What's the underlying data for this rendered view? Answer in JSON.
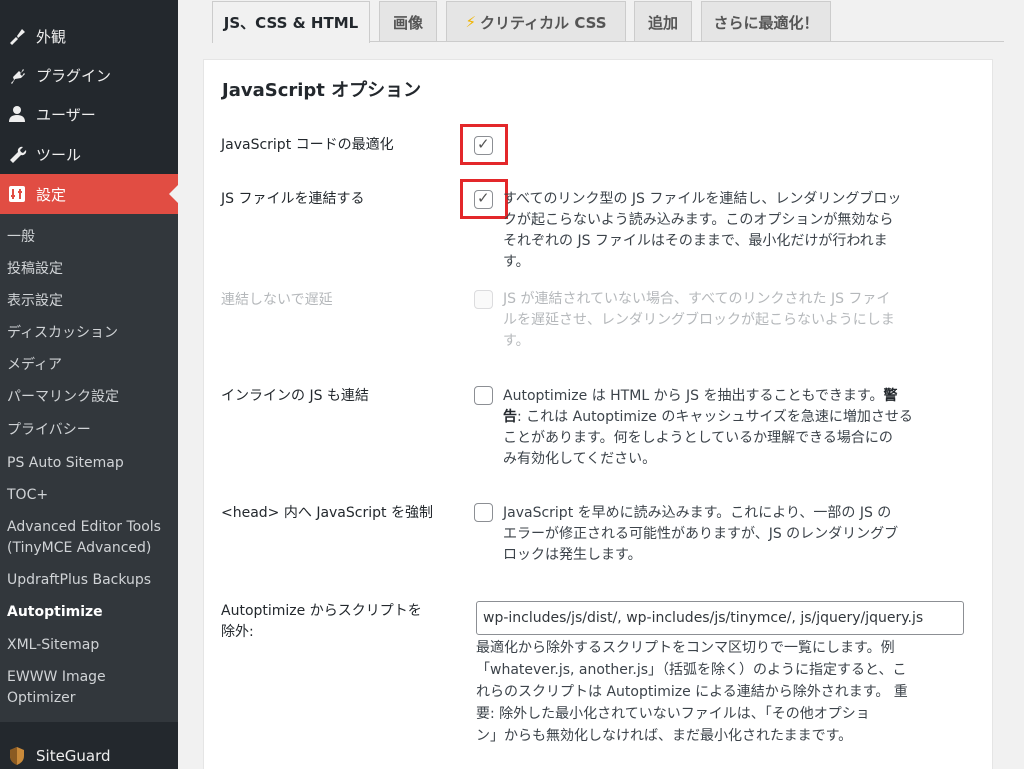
{
  "sidebar": {
    "top_items": [
      {
        "label": "外観",
        "icon": "paintbrush-icon"
      },
      {
        "label": "プラグイン",
        "icon": "plugin-icon"
      },
      {
        "label": "ユーザー",
        "icon": "user-icon"
      },
      {
        "label": "ツール",
        "icon": "wrench-icon"
      },
      {
        "label": "設定",
        "icon": "settings-icon"
      }
    ],
    "submenu": [
      "一般",
      "投稿設定",
      "表示設定",
      "ディスカッション",
      "メディア",
      "パーマリンク設定",
      "プライバシー",
      "PS Auto Sitemap",
      "TOC+",
      "Advanced Editor Tools",
      "(TinyMCE Advanced)",
      "UpdraftPlus Backups",
      "Autoptimize",
      "XML-Sitemap",
      "EWWW Image",
      "Optimizer"
    ],
    "siteguard": "SiteGuard"
  },
  "tabs": [
    "JS、CSS & HTML",
    "画像",
    "クリティカル CSS",
    "追加",
    "さらに最適化！"
  ],
  "tab_lightning": "⚡",
  "panel": {
    "title": "JavaScript オプション",
    "rows": [
      {
        "label": "JavaScript コードの最適化",
        "checked": true
      },
      {
        "label": "JS ファイルを連結する",
        "checked": true,
        "desc": [
          "すべてのリンク型の JS ファイルを連結し、レンダリングブロッ",
          "クが起こらないよう読み込みます。このオプションが無効なら",
          "それぞれの JS ファイルはそのままで、最小化だけが行われま",
          "す。"
        ]
      },
      {
        "label": "連結しないで遅延",
        "checked": false,
        "disabled": true,
        "desc": [
          "JS が連結されていない場合、すべてのリンクされた JS ファイ",
          "ルを遅延させ、レンダリングブロックが起こらないようにしま",
          "す。"
        ]
      },
      {
        "label": "インラインの JS も連結",
        "checked": false,
        "desc_a": "Autoptimize は HTML から JS を抽出することもできます。",
        "desc_warn": "警告",
        "desc": [
          "告",
          ": これは Autoptimize のキャッシュサイズを急速に増加させる",
          "ことがあります。何をしようとしているか理解できる場合にの",
          "み有効化してください。"
        ]
      },
      {
        "label": "<head> 内へ JavaScript を強制",
        "checked": false,
        "desc": [
          "JavaScript を早めに読み込みます。これにより、一部の JS の",
          "エラーが修正される可能性がありますが、JS のレンダリングブ",
          "ロックは発生します。"
        ]
      },
      {
        "label_lines": [
          "Autoptimize からスクリプトを",
          "除外:"
        ],
        "input_value": "wp-includes/js/dist/, wp-includes/js/tinymce/, js/jquery/jquery.js",
        "help": [
          "最適化から除外するスクリプトをコンマ区切りで一覧にします。例",
          "「whatever.js, another.js」（括弧を除く）のように指定すると、こ",
          "れらのスクリプトは Autoptimize による連結から除外されます。 重",
          "要: 除外した最小化されていないファイルは、「その他オプショ",
          "ン」からも無効化しなければ、まだ最小化されたままです。"
        ]
      }
    ]
  },
  "colors": {
    "accent": "#e14d43",
    "highlight": "#e3272a",
    "sidebar": "#23282d"
  }
}
